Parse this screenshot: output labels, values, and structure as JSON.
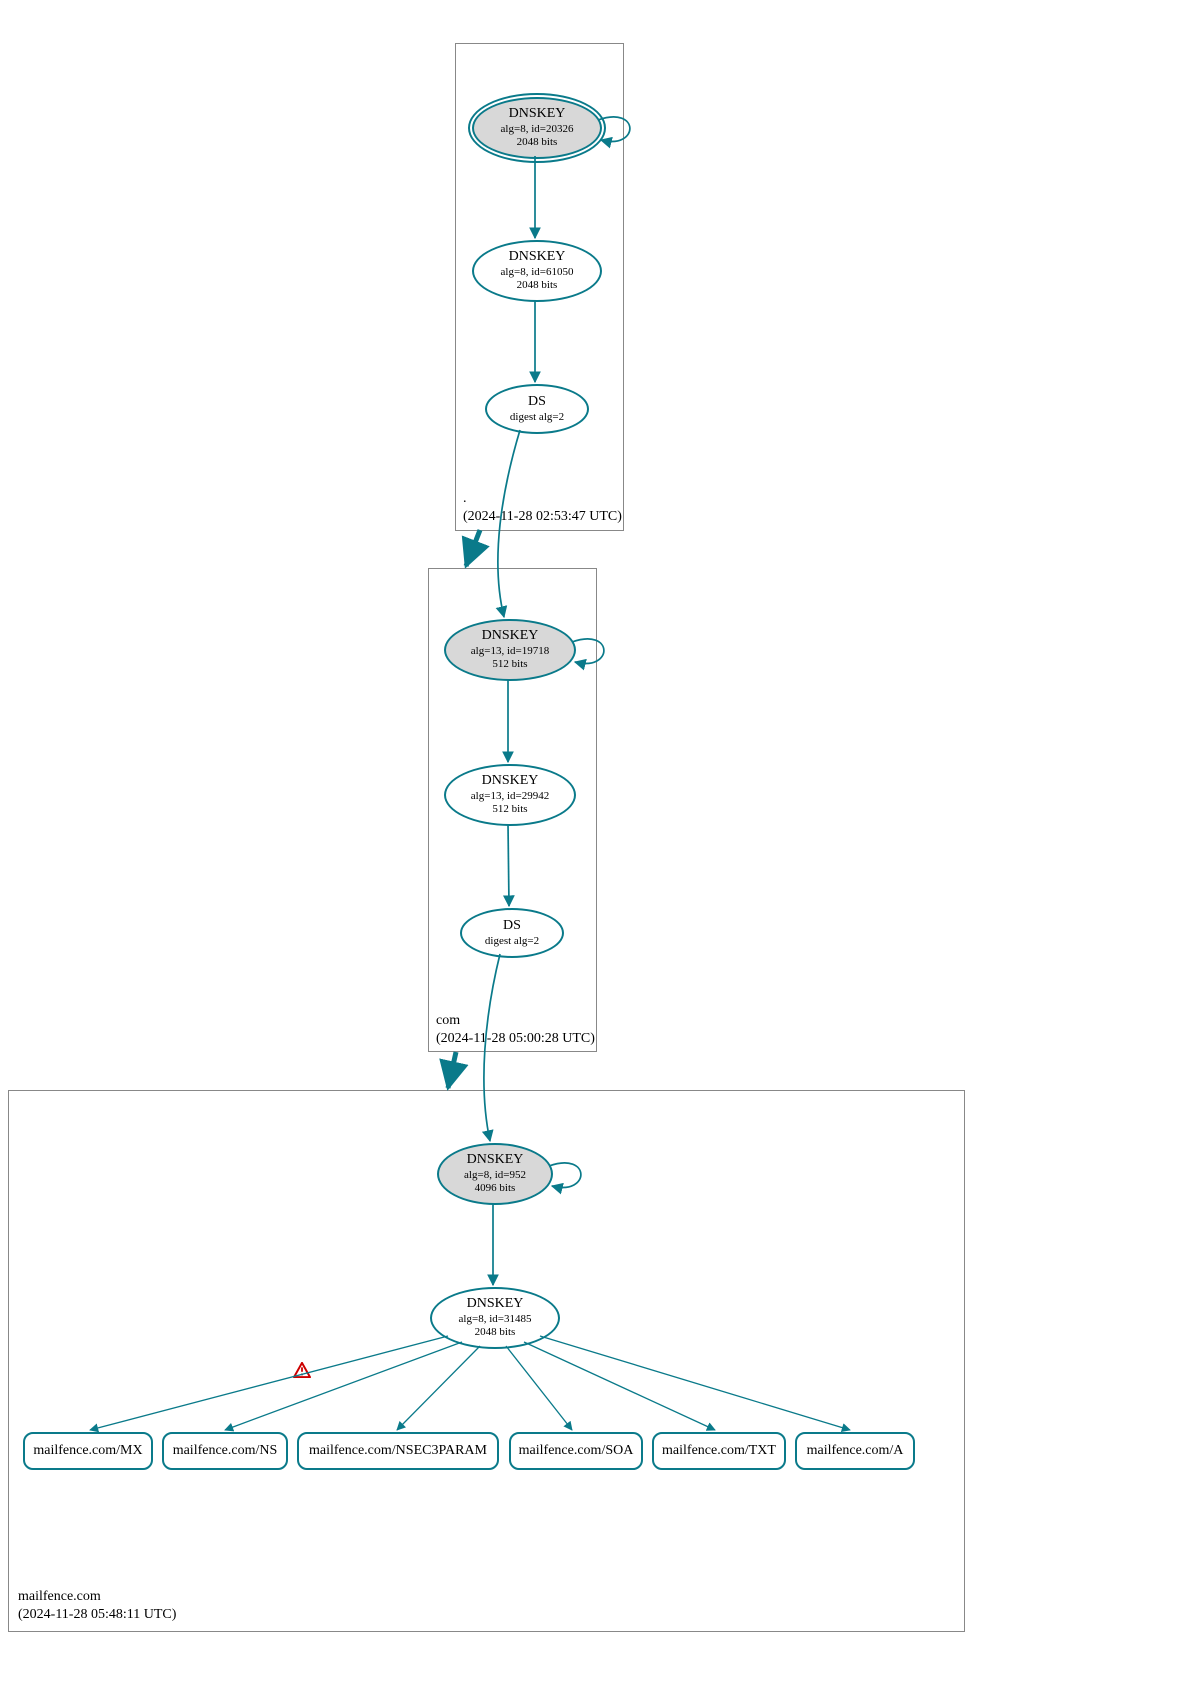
{
  "zones": {
    "root": {
      "name": ".",
      "timestamp": "(2024-11-28 02:53:47 UTC)"
    },
    "com": {
      "name": "com",
      "timestamp": "(2024-11-28 05:00:28 UTC)"
    },
    "mailfence": {
      "name": "mailfence.com",
      "timestamp": "(2024-11-28 05:48:11 UTC)"
    }
  },
  "nodes": {
    "root_ksk": {
      "title": "DNSKEY",
      "line2": "alg=8, id=20326",
      "line3": "2048 bits"
    },
    "root_zsk": {
      "title": "DNSKEY",
      "line2": "alg=8, id=61050",
      "line3": "2048 bits"
    },
    "root_ds": {
      "title": "DS",
      "line2": "digest alg=2"
    },
    "com_ksk": {
      "title": "DNSKEY",
      "line2": "alg=13, id=19718",
      "line3": "512 bits"
    },
    "com_zsk": {
      "title": "DNSKEY",
      "line2": "alg=13, id=29942",
      "line3": "512 bits"
    },
    "com_ds": {
      "title": "DS",
      "line2": "digest alg=2"
    },
    "mf_ksk": {
      "title": "DNSKEY",
      "line2": "alg=8, id=952",
      "line3": "4096 bits"
    },
    "mf_zsk": {
      "title": "DNSKEY",
      "line2": "alg=8, id=31485",
      "line3": "2048 bits"
    }
  },
  "records": {
    "mx": "mailfence.com/MX",
    "ns": "mailfence.com/NS",
    "nsec": "mailfence.com/NSEC3PARAM",
    "soa": "mailfence.com/SOA",
    "txt": "mailfence.com/TXT",
    "a": "mailfence.com/A"
  },
  "colors": {
    "edge": "#0a7a8a",
    "warn": "#cc0000"
  }
}
